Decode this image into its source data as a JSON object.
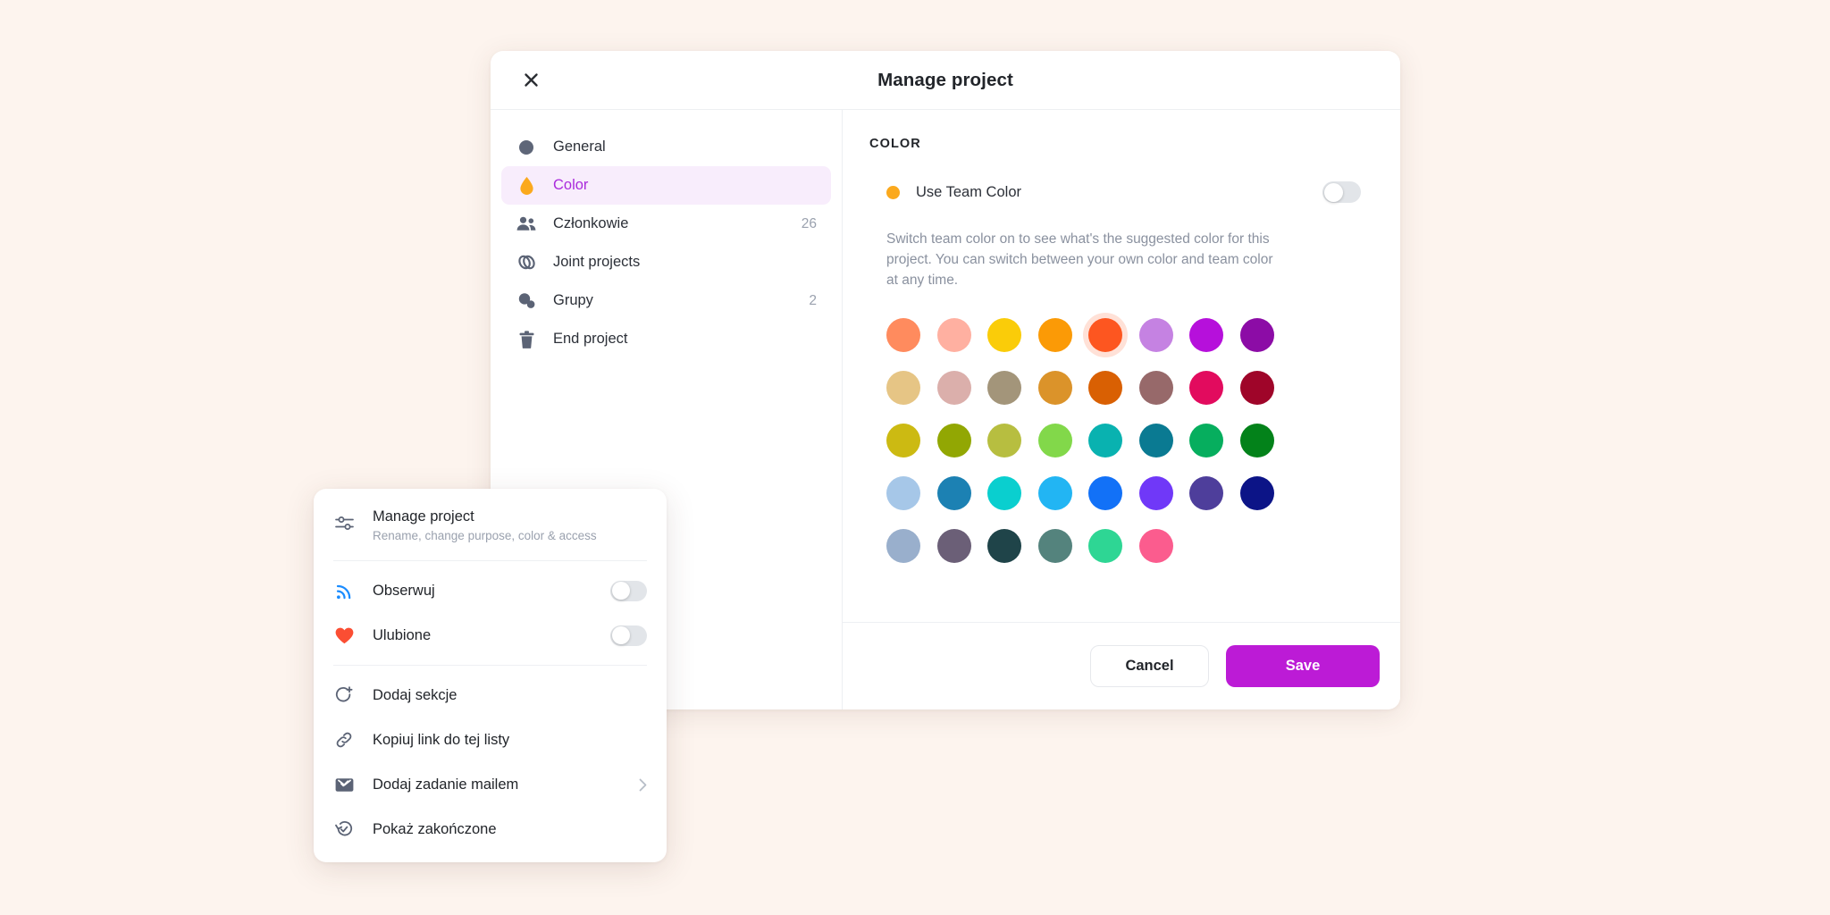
{
  "modal": {
    "title": "Manage project",
    "close_icon": "close-icon"
  },
  "sidebar": {
    "items": [
      {
        "label": "General",
        "icon": "circle-icon",
        "count": ""
      },
      {
        "label": "Color",
        "icon": "droplet-icon",
        "count": "",
        "active": true
      },
      {
        "label": "Członkowie",
        "icon": "members-icon",
        "count": "26"
      },
      {
        "label": "Joint projects",
        "icon": "joint-projects-icon",
        "count": ""
      },
      {
        "label": "Grupy",
        "icon": "groups-icon",
        "count": "2"
      },
      {
        "label": "End project",
        "icon": "trash-icon",
        "count": ""
      }
    ]
  },
  "content": {
    "section_title": "COLOR",
    "team_color_label": "Use Team Color",
    "team_color_dot": "#FBA91D",
    "team_toggle_on": false,
    "description": "Switch team color on to see what's the suggested color for this project. You can switch between your own color and team color at any time.",
    "selected_swatch_index": 4,
    "selection_ring_color": "#FFE1D7",
    "swatch_rows": [
      [
        "#FF8B5E",
        "#FFB0A1",
        "#FACC09",
        "#FB9A06",
        "#FD5620",
        "#C582E2",
        "#B610DB",
        "#8C0CA6"
      ],
      [
        "#E6C585",
        "#DBAFAB",
        "#A3957A",
        "#DB932A",
        "#D96003",
        "#97696A",
        "#E20B5E",
        "#9F0529"
      ],
      [
        "#CCBA12",
        "#92A703",
        "#B7BE40",
        "#82D84A",
        "#09B2B0",
        "#0A7A92",
        "#06AE5E",
        "#03821A"
      ],
      [
        "#A6C7E8",
        "#1C81B3",
        "#0ACFCF",
        "#22B5F3",
        "#1271F7",
        "#7038F8",
        "#4E3E9B",
        "#0C1487"
      ],
      [
        "#99AFCC",
        "#6B5F77",
        "#1F4449",
        "#54837D",
        "#2ED694",
        "#FB5C8E",
        "",
        ""
      ]
    ]
  },
  "footer": {
    "cancel_label": "Cancel",
    "save_label": "Save",
    "save_color": "#BC1BD6"
  },
  "context_menu": {
    "header": {
      "title": "Manage project",
      "subtitle": "Rename, change purpose, color & access",
      "icon": "sliders-icon"
    },
    "toggles": [
      {
        "label": "Obserwuj",
        "icon": "rss-icon",
        "icon_color": "#1A8CFF",
        "on": false
      },
      {
        "label": "Ulubione",
        "icon": "heart-icon",
        "icon_color": "#FB4E33",
        "on": false
      }
    ],
    "items": [
      {
        "label": "Dodaj sekcje",
        "icon": "add-section-icon",
        "chevron": false
      },
      {
        "label": "Kopiuj link do tej listy",
        "icon": "link-icon",
        "chevron": false
      },
      {
        "label": "Dodaj zadanie mailem",
        "icon": "email-task-icon",
        "chevron": true
      },
      {
        "label": "Pokaż zakończone",
        "icon": "history-check-icon",
        "chevron": false
      }
    ]
  }
}
